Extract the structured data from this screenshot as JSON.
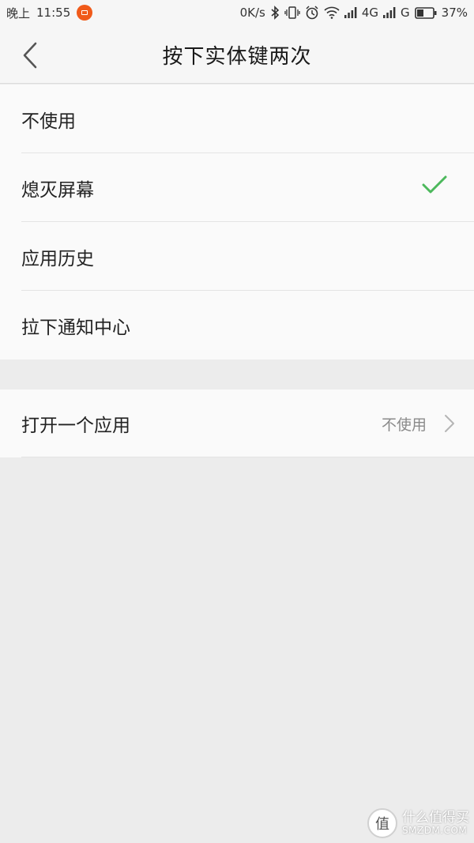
{
  "status_bar": {
    "period": "晚上",
    "time": "11:55",
    "net_speed": "0K/s",
    "network_4g": "4G",
    "network_g": "G",
    "battery": "37%"
  },
  "header": {
    "title": "按下实体键两次"
  },
  "options": [
    {
      "label": "不使用",
      "selected": false
    },
    {
      "label": "熄灭屏幕",
      "selected": true
    },
    {
      "label": "应用历史",
      "selected": false
    },
    {
      "label": "拉下通知中心",
      "selected": false
    }
  ],
  "open_app": {
    "label": "打开一个应用",
    "value": "不使用"
  },
  "watermark": {
    "logo_char": "值",
    "cn": "什么值得买",
    "en": "SMZDM.COM"
  },
  "colors": {
    "accent_check": "#4cb85c",
    "notification_badge": "#f05a1a"
  }
}
